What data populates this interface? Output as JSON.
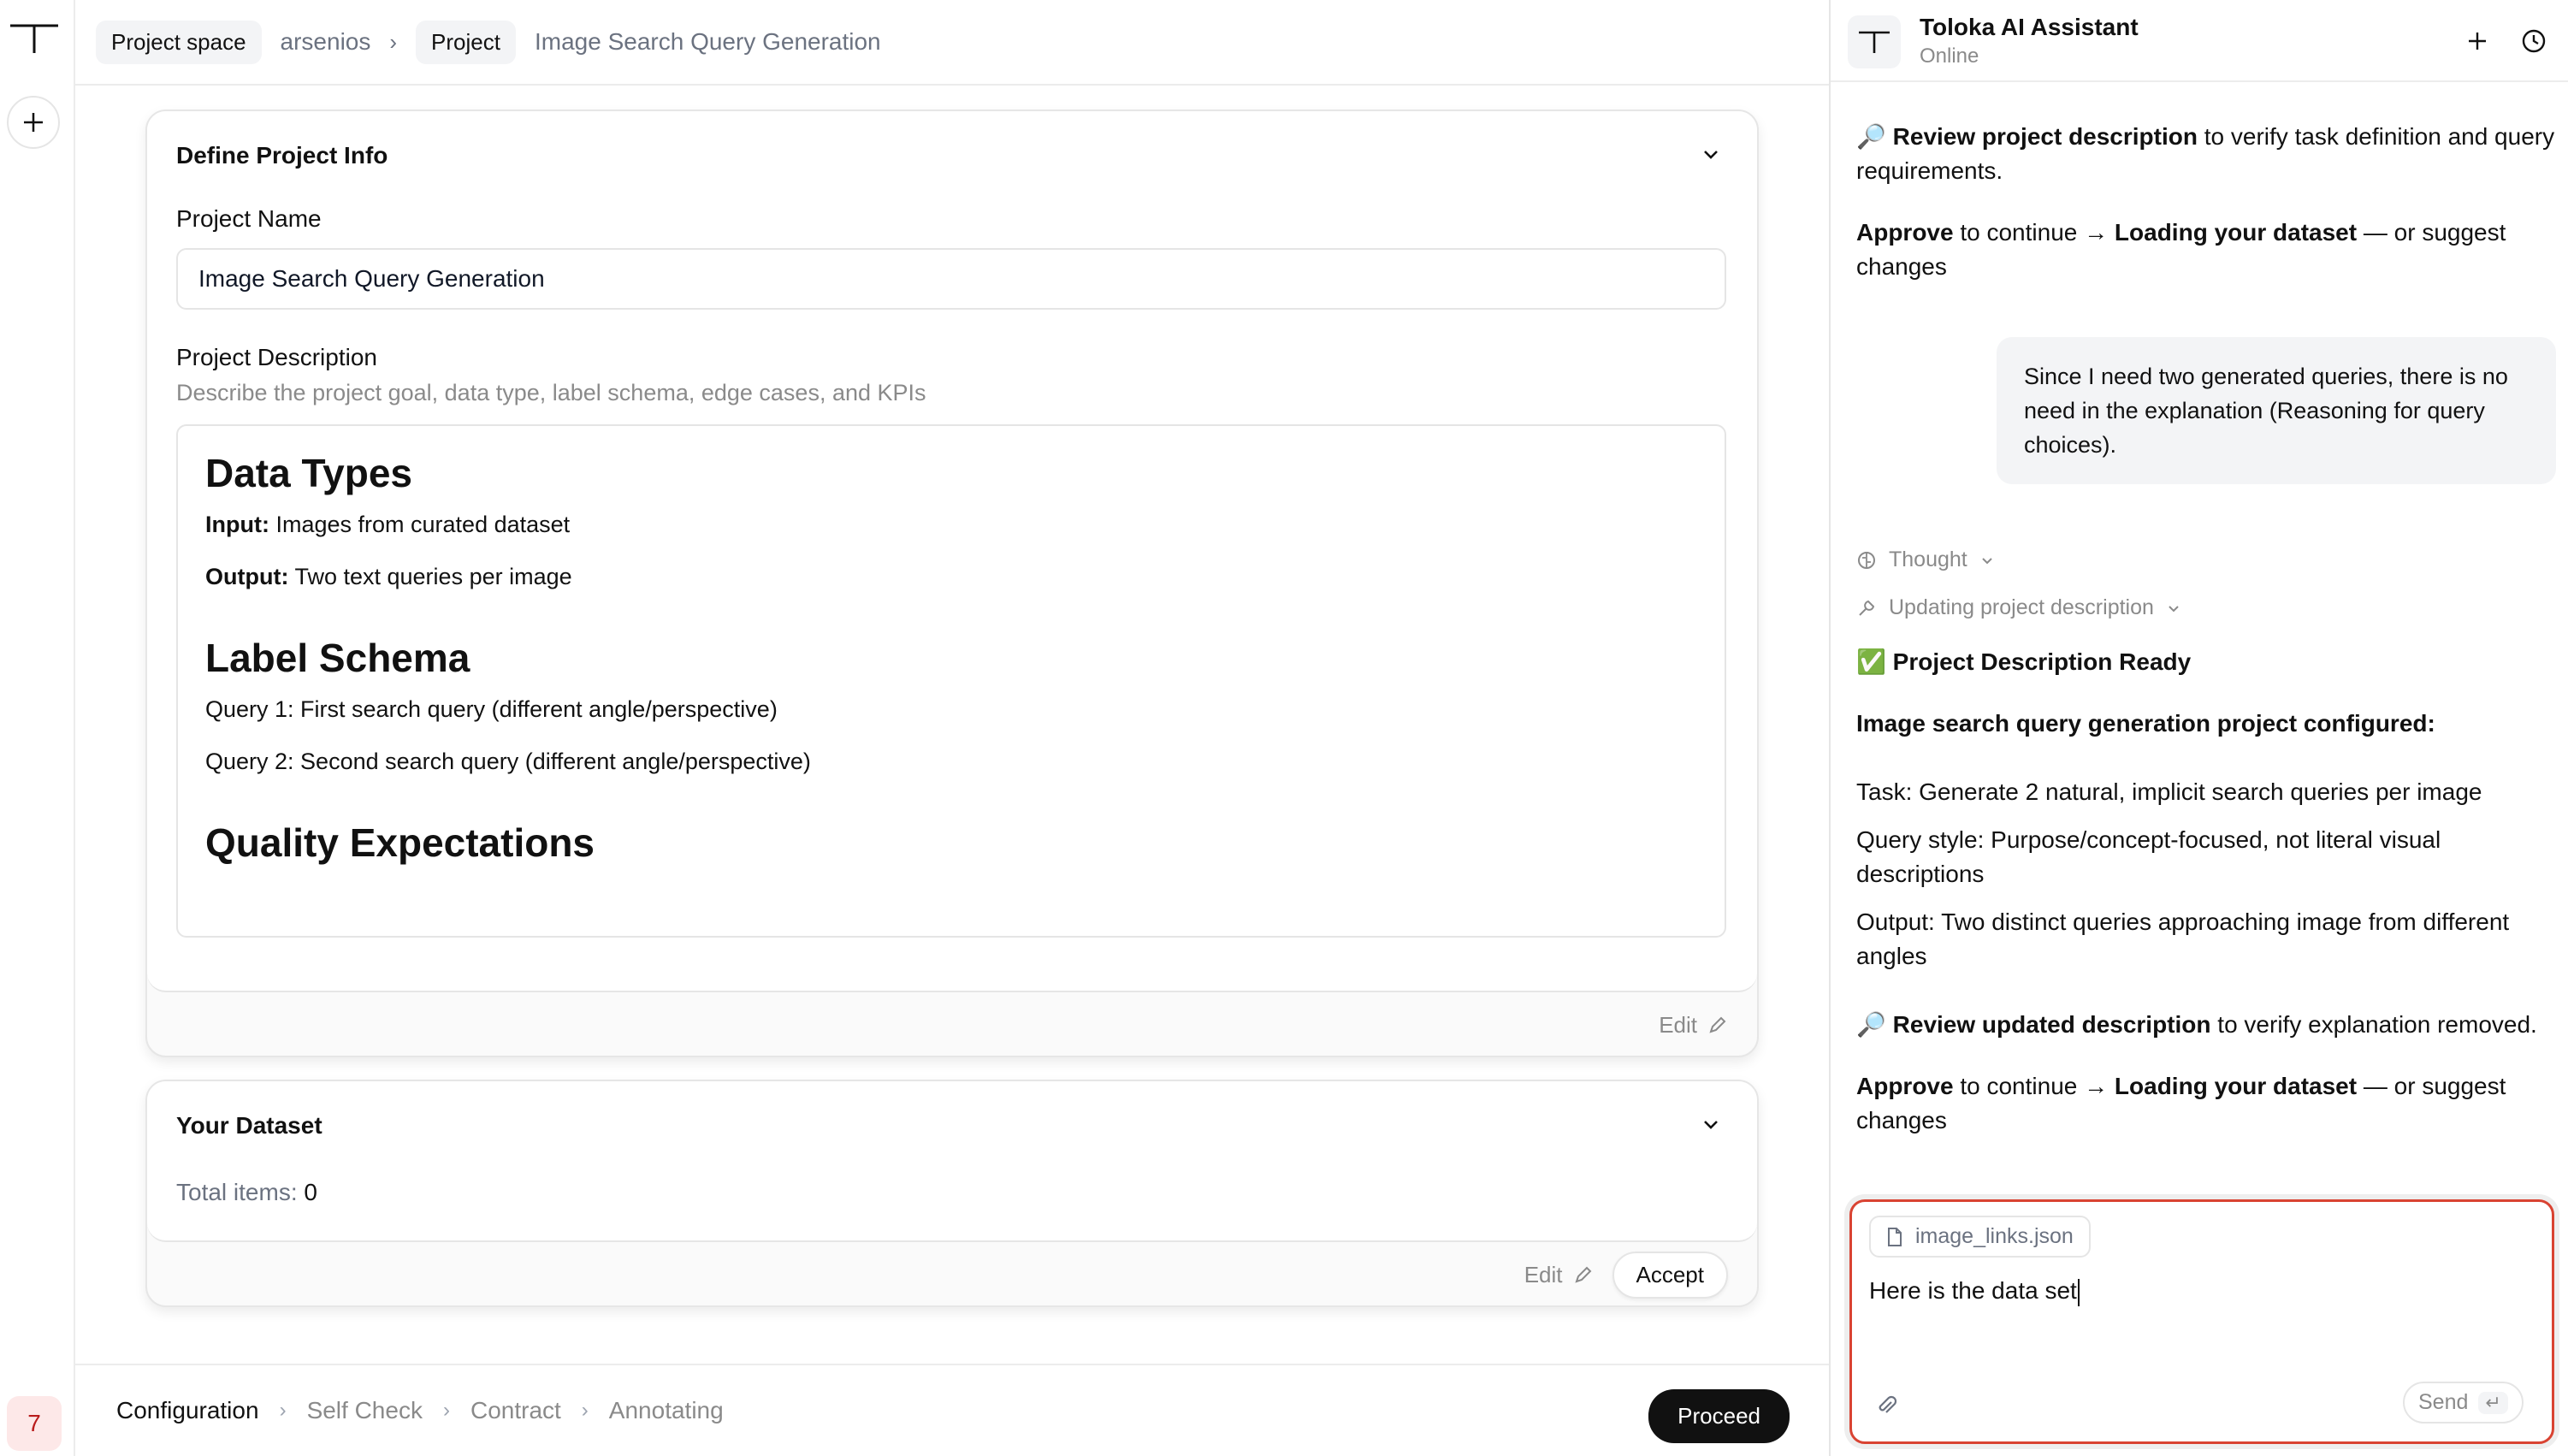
{
  "rail": {
    "badge": "7"
  },
  "breadcrumb": {
    "project_space_chip": "Project space",
    "user": "arsenios",
    "separator": "›",
    "project_chip": "Project",
    "project_name": "Image Search Query Generation"
  },
  "project_info": {
    "title": "Define Project Info",
    "name_label": "Project Name",
    "name_value": "Image Search Query Generation",
    "description_label": "Project Description",
    "description_hint": "Describe the project goal, data type, label schema, edge cases, and KPIs",
    "doc": {
      "heading_data_types": "Data Types",
      "input_label": "Input:",
      "input_value": "Images from curated dataset",
      "output_label": "Output:",
      "output_value": "Two text queries per image",
      "heading_label_schema": "Label Schema",
      "query1": "Query 1: First search query (different angle/perspective)",
      "query2": "Query 2: Second search query (different angle/perspective)",
      "heading_quality": "Quality Expectations"
    },
    "edit_label": "Edit"
  },
  "dataset": {
    "title": "Your Dataset",
    "total_label": "Total items:",
    "total_value": "0",
    "edit_label": "Edit",
    "accept_label": "Accept"
  },
  "steps": {
    "items": [
      "Configuration",
      "Self Check",
      "Contract",
      "Annotating"
    ],
    "separator": "›",
    "proceed_label": "Proceed"
  },
  "assistant": {
    "name": "Toloka AI Assistant",
    "status": "Online",
    "msg1": {
      "icon": "🔎",
      "bold": "Review project description",
      "rest": " to verify task definition and query requirements."
    },
    "msg2": {
      "bold1": "Approve",
      "mid": " to continue → ",
      "bold2": "Loading your dataset",
      "rest": " — or suggest changes"
    },
    "user_message": "Since I need two generated queries, there is no need in the explanation (Reasoning for query choices).",
    "thought_label": "Thought",
    "updating_label": "Updating project description",
    "ready_icon": "✅",
    "ready_label": "Project Description Ready",
    "configured_label": "Image search query generation project configured:",
    "task_line": "Task: Generate 2 natural, implicit search queries per image",
    "style_line": "Query style: Purpose/concept-focused, not literal visual descriptions",
    "output_line": "Output: Two distinct queries approaching image from different angles",
    "msg3": {
      "icon": "🔎",
      "bold": "Review updated description",
      "rest": " to verify explanation removed."
    },
    "msg4": {
      "bold1": "Approve",
      "mid": " to continue → ",
      "bold2": "Loading your dataset",
      "rest": " — or suggest changes"
    },
    "composer": {
      "file_name": "image_links.json",
      "text": "Here is the data set",
      "send_label": "Send",
      "send_key": "↵"
    }
  }
}
